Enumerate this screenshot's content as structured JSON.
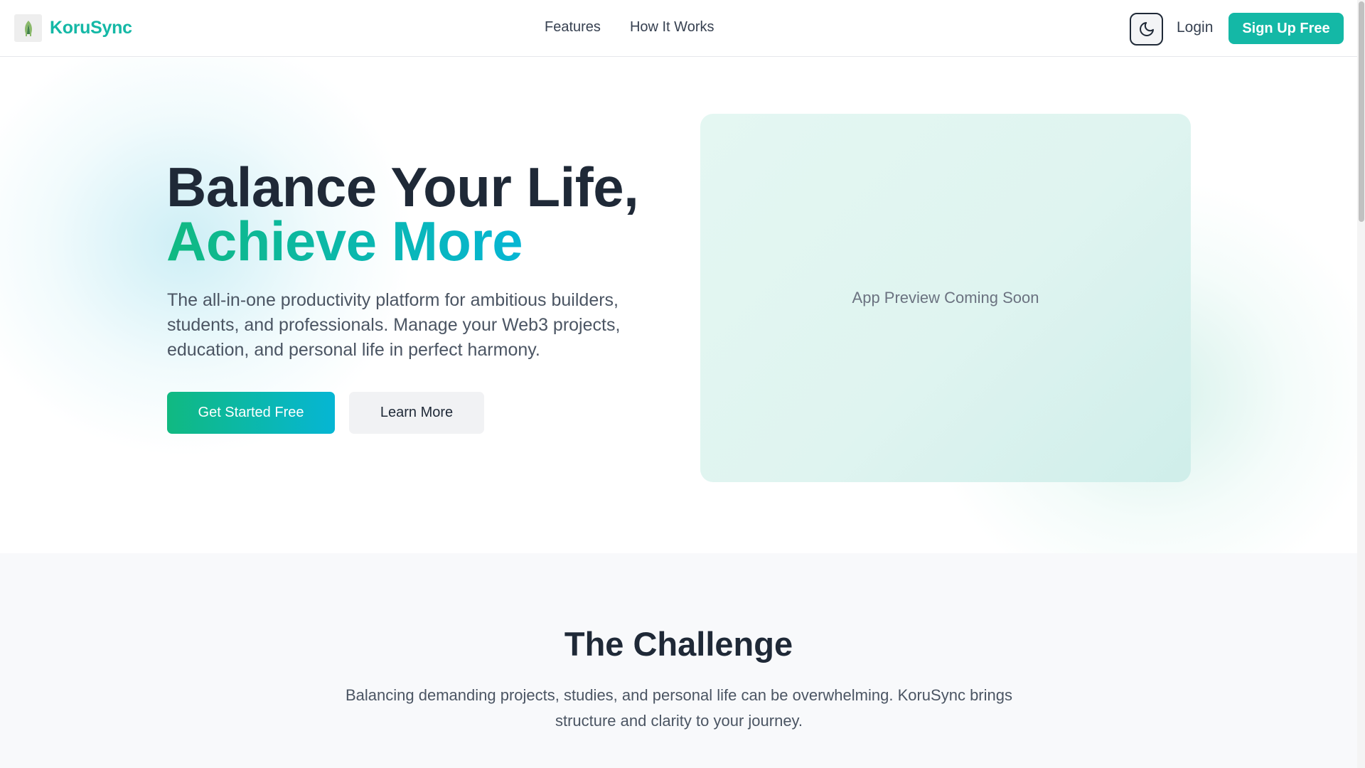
{
  "nav": {
    "brand": "KoruSync",
    "logo_icon": "leaf-logo-icon",
    "links": [
      "Features",
      "How It Works"
    ],
    "theme_toggle_icon": "moon-icon",
    "login": "Login",
    "signup": "Sign Up Free"
  },
  "hero": {
    "title_line1": "Balance Your Life,",
    "title_line2": "Achieve More",
    "subtitle": "The all-in-one productivity platform for ambitious builders, students, and professionals. Manage your Web3 projects, education, and personal life in perfect harmony.",
    "primary_button": "Get Started Free",
    "secondary_button": "Learn More",
    "preview_text": "App Preview Coming Soon"
  },
  "challenge": {
    "title": "The Challenge",
    "subtitle": "Balancing demanding projects, studies, and personal life can be overwhelming. KoruSync brings structure and clarity to your journey."
  },
  "colors": {
    "brand": "#14b8a6",
    "gradient_start": "#10b981",
    "gradient_end": "#06b6d4",
    "text_dark": "#1f2937",
    "text_muted": "#4b5563"
  }
}
